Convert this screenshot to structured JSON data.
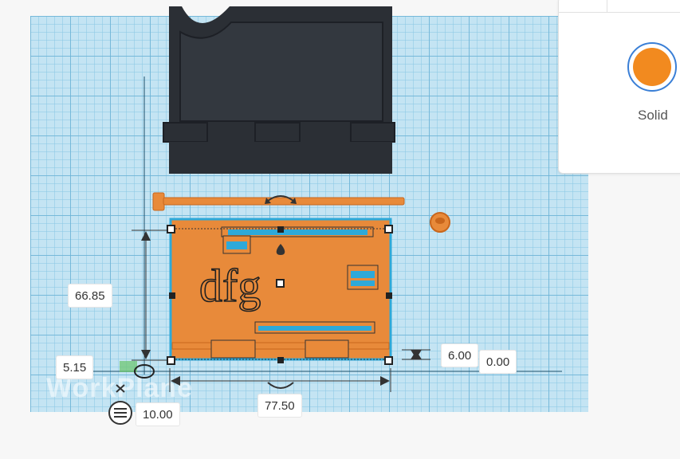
{
  "workplane": {
    "label": "WorkPlane"
  },
  "panel": {
    "solid_label": "Solid",
    "solid_color": "#f28a1f"
  },
  "canvas": {
    "logo_text": "dfg"
  },
  "dimensions": {
    "height": "66.85",
    "width": "77.50",
    "depth": "6.00",
    "elevation": "0.00",
    "x_offset": "5.15",
    "y_offset": "10.00"
  },
  "colors": {
    "orange": "#e88a3a",
    "orange_dark": "#c9661c",
    "blue": "#2ea9d9",
    "black_part": "#2b2f35"
  }
}
